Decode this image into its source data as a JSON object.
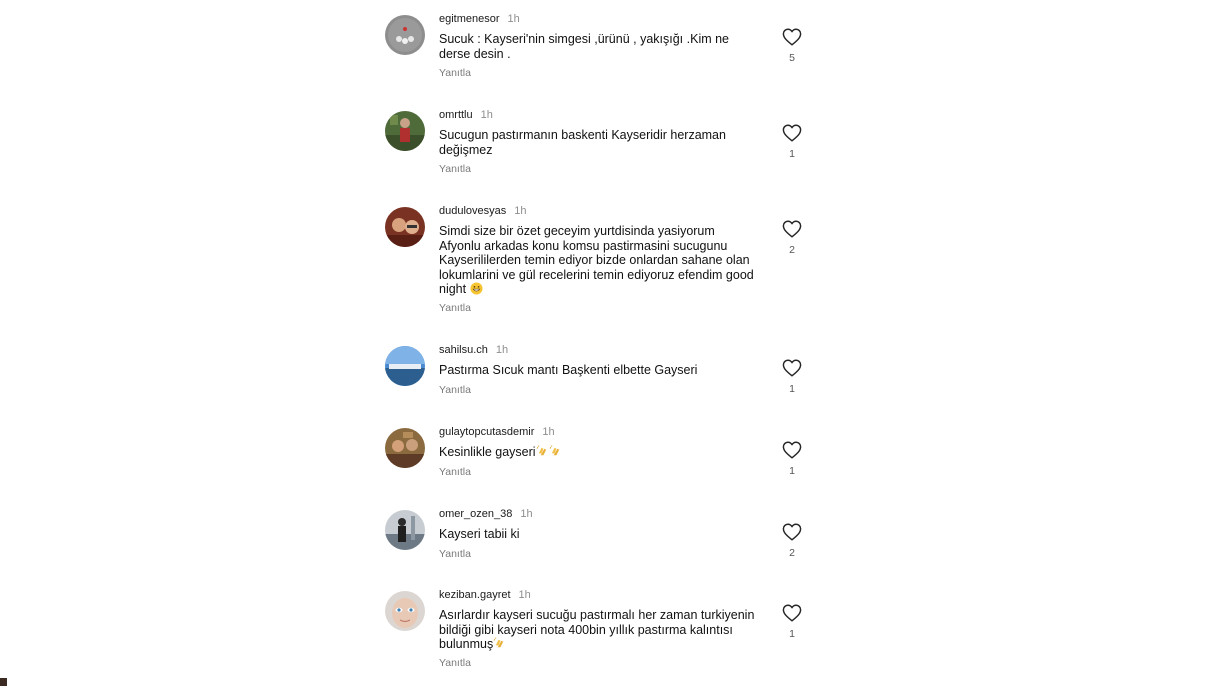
{
  "comments": [
    {
      "username": "egitmenesor",
      "time": "1h",
      "text": "Sucuk : Kayseri'nin simgesi ,ürünü , yakışığı .Kim ne derse desin .",
      "reply_label": "Yanıtla",
      "likes": "5",
      "avatar": "avatar-icon"
    },
    {
      "username": "omrttlu",
      "time": "1h",
      "text": "Sucugun pastırmanın baskenti Kayseridir herzaman değişmez",
      "reply_label": "Yanıtla",
      "likes": "1",
      "avatar": "avatar-icon"
    },
    {
      "username": "dudulovesyas",
      "time": "1h",
      "text": "Simdi size bir özet geceyim yurtdisinda yasiyorum Afyonlu arkadas konu komsu pastirmasini sucugunu Kayserililerden temin ediyor bizde onlardan sahane olan lokumlarini ve gül recelerini temin ediyoruz efendim good night",
      "emoji": "grinning-face-emoji",
      "reply_label": "Yanıtla",
      "likes": "2",
      "avatar": "avatar-icon"
    },
    {
      "username": "sahilsu.ch",
      "time": "1h",
      "text": "Pastırma Sıcuk mantı Başkenti elbette Gayseri",
      "reply_label": "Yanıtla",
      "likes": "1",
      "avatar": "avatar-icon"
    },
    {
      "username": "gulaytopcutasdemir",
      "time": "1h",
      "text": "Kesinlikle gayseri",
      "emoji": "clapping-hands-emoji",
      "reply_label": "Yanıtla",
      "likes": "1",
      "avatar": "avatar-icon"
    },
    {
      "username": "omer_ozen_38",
      "time": "1h",
      "text": "Kayseri tabii ki",
      "reply_label": "Yanıtla",
      "likes": "2",
      "avatar": "avatar-icon"
    },
    {
      "username": "keziban.gayret",
      "time": "1h",
      "text": "Asırlardır kayseri sucuğu pastırmalı her zaman turkiyenin bildiği gibi kayseri nota 400bin yıllık pastırma kalıntısı bulunmuş",
      "emoji": "clapping-hands-emoji",
      "reply_label": "Yanıtla",
      "likes": "1",
      "avatar": "avatar-icon"
    }
  ],
  "colors": {
    "text": "#111111",
    "meta": "#8e8e8e",
    "reply": "#7a7a7a",
    "heart": "#262626",
    "background": "#ffffff"
  },
  "icons": {
    "like": "heart-outline-icon"
  }
}
